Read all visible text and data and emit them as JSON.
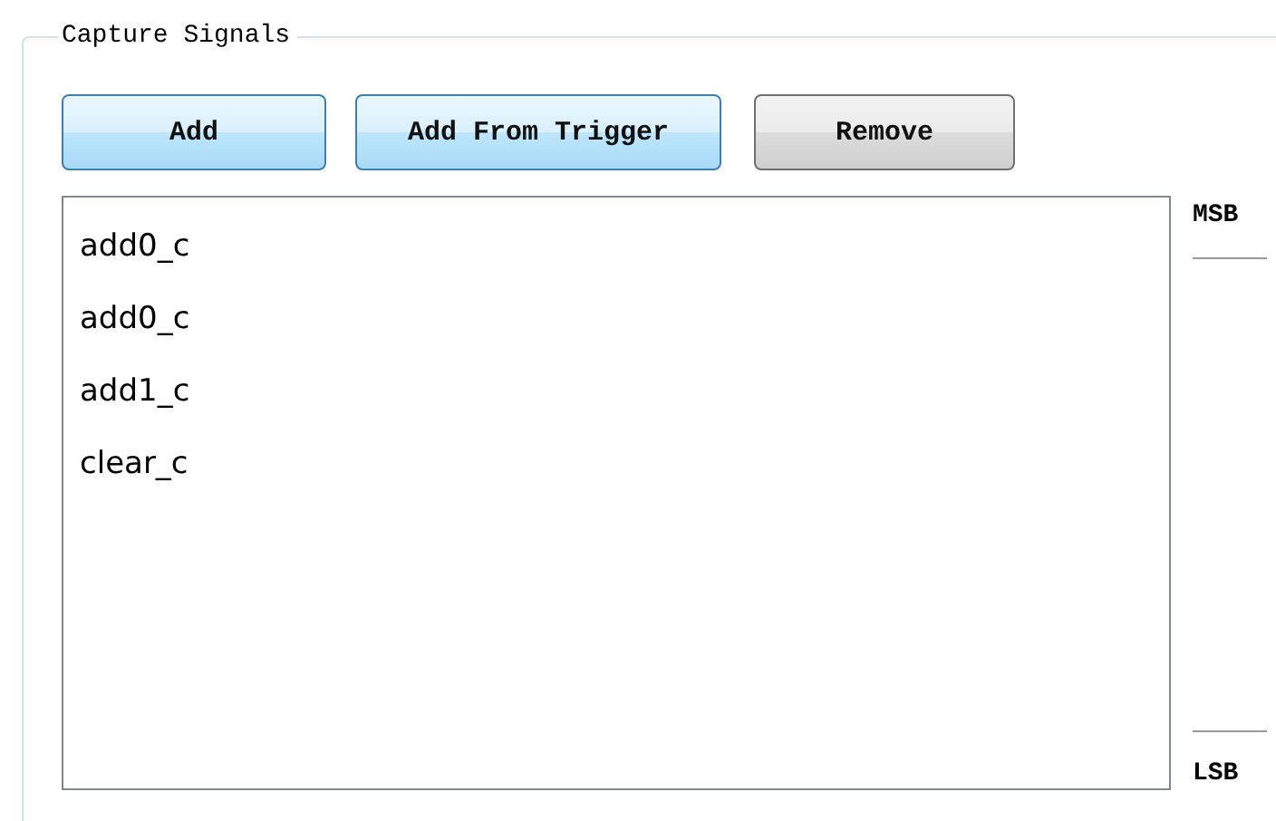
{
  "group": {
    "title": "Capture Signals"
  },
  "buttons": [
    {
      "label": "Add",
      "highlighted": true
    },
    {
      "label": "Add From Trigger",
      "highlighted": true
    },
    {
      "label": "Remove",
      "highlighted": false
    }
  ],
  "signals": [
    "add0_c",
    "add0_c",
    "add1_c",
    "clear_c"
  ],
  "order": {
    "top_label": "MSB",
    "bottom_label": "LSB"
  }
}
